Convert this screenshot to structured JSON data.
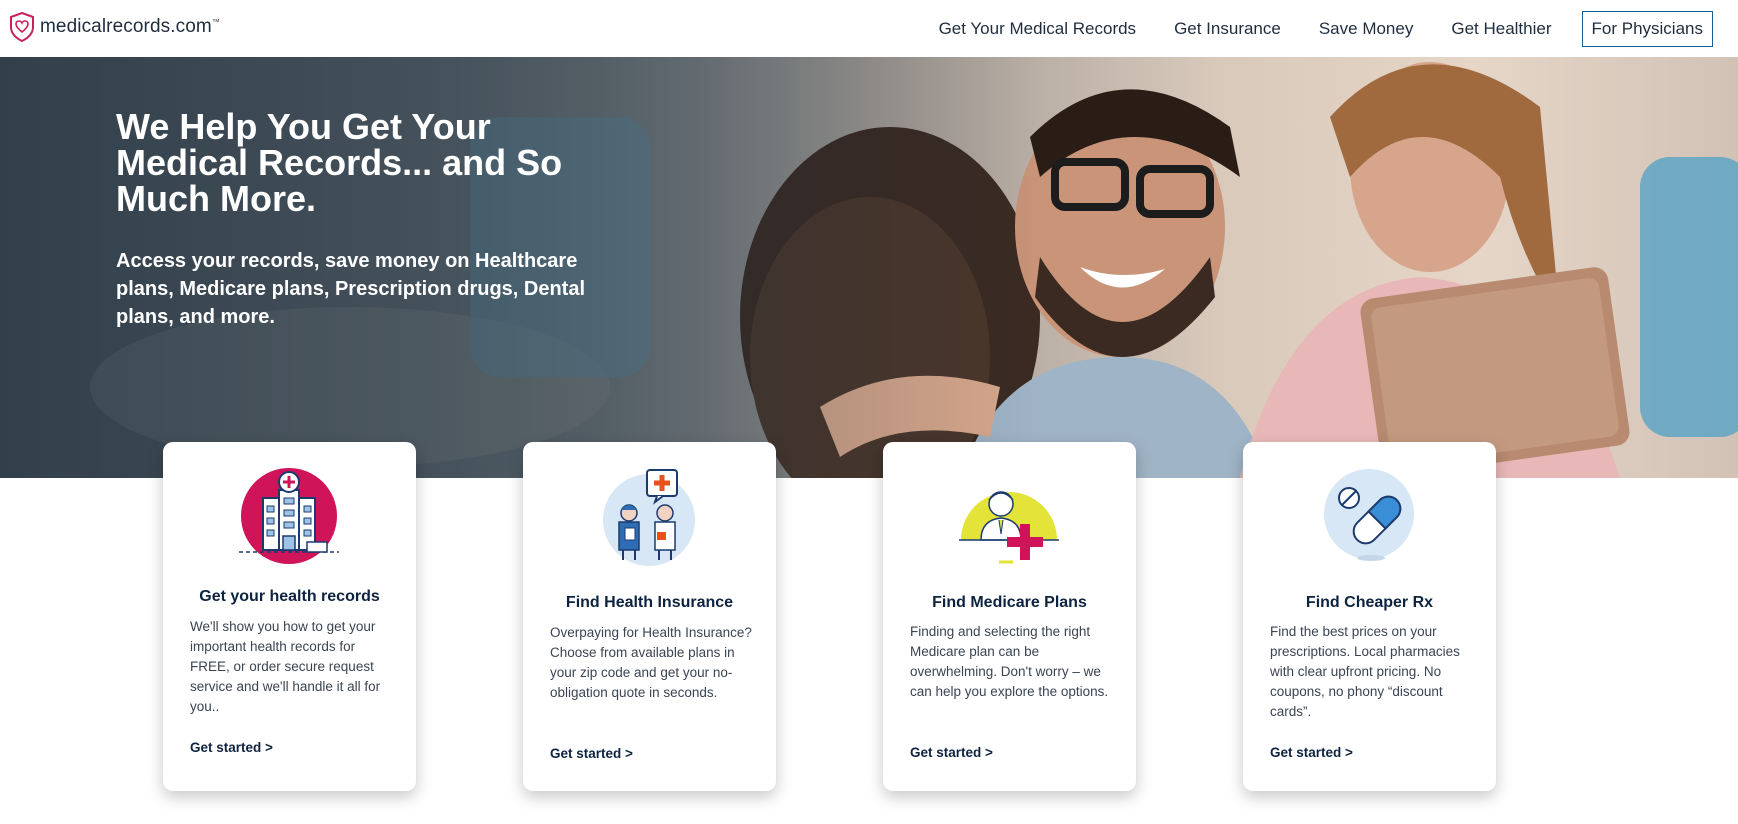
{
  "header": {
    "logo_text": "medicalrecords.com",
    "logo_tm": "™",
    "nav": [
      {
        "label": "Get Your Medical Records"
      },
      {
        "label": "Get Insurance"
      },
      {
        "label": "Save Money"
      },
      {
        "label": "Get Healthier"
      }
    ],
    "physicians_label": "For Physicians"
  },
  "hero": {
    "title": "We Help You Get Your Medical Records... and So Much More.",
    "subtitle": "Access your records, save money on Healthcare plans, Medicare plans, Prescription drugs, Dental plans, and more."
  },
  "cards": [
    {
      "icon": "hospital-icon",
      "title": "Get your health records",
      "text": "We'll show you how to get your important health records for FREE, or order secure request service and we'll handle it all for you..",
      "link": "Get started >"
    },
    {
      "icon": "doctors-icon",
      "title": "Find Health Insurance",
      "text": "Overpaying for Health Insurance? Choose from available plans in your zip code and get your no-obligation quote in seconds.",
      "link": "Get started >"
    },
    {
      "icon": "medicare-doctor-icon",
      "title": "Find Medicare Plans",
      "text": "Finding and selecting the right Medicare plan can be overwhelming. Don't worry – we can help you explore the options.",
      "link": "Get started >"
    },
    {
      "icon": "pill-icon",
      "title": "Find Cheaper Rx",
      "text": "Find the best prices on your prescriptions. Local pharmacies with clear upfront pricing. No coupons, no phony “discount cards”.",
      "link": "Get started >"
    }
  ],
  "colors": {
    "navy": "#0d2340",
    "accent_pink": "#d0145a",
    "light_blue": "#d8e7f5",
    "yellow": "#e3e339",
    "nav_border": "#1a5e96"
  }
}
